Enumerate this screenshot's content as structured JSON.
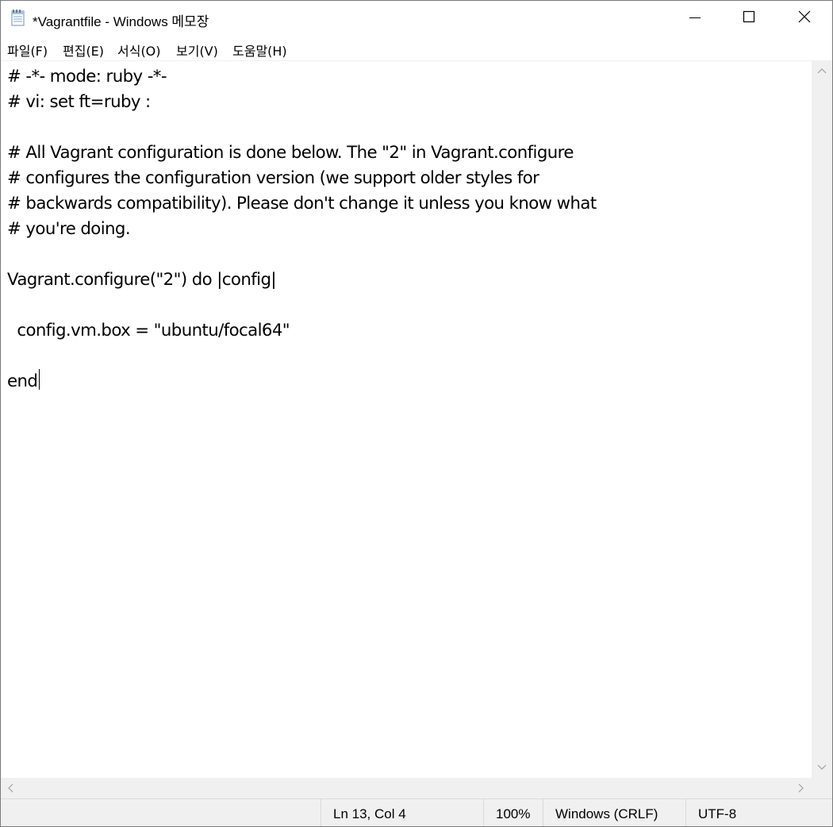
{
  "window": {
    "title": "*Vagrantfile - Windows 메모장"
  },
  "menu": [
    {
      "label": "파일(F)"
    },
    {
      "label": "편집(E)"
    },
    {
      "label": "서식(O)"
    },
    {
      "label": "보기(V)"
    },
    {
      "label": "도움말(H)"
    }
  ],
  "editor": {
    "lines": [
      "# -*- mode: ruby -*-",
      "# vi: set ft=ruby :",
      "",
      "# All Vagrant configuration is done below. The \"2\" in Vagrant.configure",
      "# configures the configuration version (we support older styles for",
      "# backwards compatibility). Please don't change it unless you know what",
      "# you're doing.",
      "",
      "Vagrant.configure(\"2\") do |config|",
      "",
      "  config.vm.box = \"ubuntu/focal64\"",
      "",
      "end"
    ]
  },
  "status": {
    "position": "Ln 13, Col 4",
    "zoom": "100%",
    "line_ending": "Windows (CRLF)",
    "encoding": "UTF-8"
  },
  "icons": {
    "app": "notepad-icon",
    "minimize": "minimize-icon",
    "maximize": "maximize-icon",
    "close": "close-icon"
  }
}
